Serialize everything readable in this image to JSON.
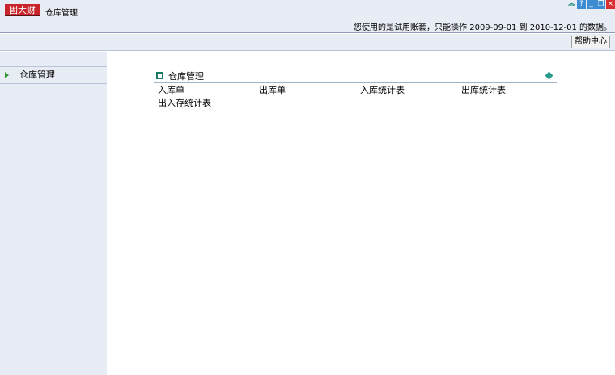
{
  "header": {
    "logo": "固大财",
    "title": "仓库管理",
    "notice": "您使用的是试用账套，只能操作 2009-09-01 到 2010-12-01 的数据。",
    "window_buttons": [
      "collapse-icon",
      "help-icon",
      "minimize-icon",
      "restore-icon",
      "close-icon"
    ]
  },
  "toolbar": {
    "help_label": "帮助中心"
  },
  "sidebar": {
    "items": [
      {
        "label": "仓库管理"
      }
    ]
  },
  "panel": {
    "title": "仓库管理",
    "links": [
      {
        "label": "入库单"
      },
      {
        "label": "出库单"
      },
      {
        "label": "入库统计表"
      },
      {
        "label": "出库统计表"
      },
      {
        "label": "出入存统计表"
      }
    ]
  }
}
